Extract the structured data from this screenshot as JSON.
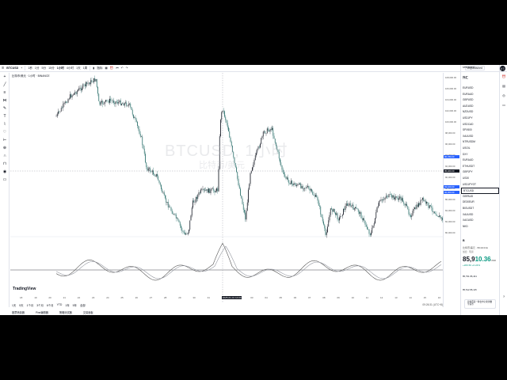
{
  "topbar": {
    "symbol": "BTCUSD",
    "intervals": [
      "1秒",
      "1分",
      "5分",
      "15分",
      "1小时",
      "4小时",
      "1天",
      "1周"
    ],
    "indicators_label": "指标",
    "publish_label": "Unpublished",
    "avatar_label": "分享"
  },
  "legend": "比特币/美元 · 1小时 · BINANCE",
  "watermark": {
    "main": "BTCUSD, 1小时",
    "sub": "比特币/美元"
  },
  "logo": "TradingView",
  "time_ticks": [
    "18",
    "19",
    "20",
    "21",
    "22",
    "23",
    "24",
    "25",
    "26",
    "27",
    "28",
    "29",
    "30",
    "31",
    "2025-01-01 14:00",
    "02",
    "03",
    "04",
    "05",
    "06",
    "07",
    "08",
    "09",
    "10",
    "11",
    "12",
    "13",
    "14",
    "15",
    "16"
  ],
  "price_labels": [
    "108,000.00",
    "106,000.00",
    "104,000.00",
    "102,000.00",
    "100,000.00",
    "98,000.00",
    "96,000.00",
    "94,000.00",
    "92,000.00",
    "90,000.00",
    "88,000.00",
    "86,000.00",
    "84,000.00",
    "82,000.00",
    "80,000.00"
  ],
  "price_badges": [
    {
      "text": "96,780.00",
      "color": "#2962ff"
    },
    {
      "text": "95,460.00",
      "color": "#131722"
    },
    {
      "text": "93,100.00",
      "color": "#2962ff"
    },
    {
      "text": "92,300.00",
      "color": "#2962ff"
    }
  ],
  "ranges": [
    "1天",
    "5天",
    "1个月",
    "3个月",
    "6个月",
    "YTD",
    "1年",
    "5年",
    "全部"
  ],
  "clock": "09:26:31 (UTC+8)",
  "footer": [
    "股票筛选器",
    "Pine编辑器",
    "策略测试器",
    "交易面板"
  ],
  "watchlist": {
    "header": "Unnamed",
    "title": "外汇",
    "items": [
      "EURUSD",
      "EURAUD",
      "GBPUSD",
      "AUDUSD",
      "NZDUSD",
      "USDJPY",
      "USDCAD",
      "SPX500",
      "XAUUSD",
      "NTRUSDM",
      "USOIL",
      "DXY",
      "EURAUD",
      "ETHUSDT",
      "GBPJPY",
      "US30",
      "USDJPYOT",
      "BTCUSD",
      "GBPAUD",
      "DE30EUR",
      "BIGUSDT",
      "XAUUSD",
      "XAGUSD",
      "NKD"
    ],
    "selected_index": 17
  },
  "detail": {
    "symbol": "B",
    "name": "比特币/美元 · BINANCE",
    "exchange": "加密 · 现货",
    "price_int": "85,9",
    "price_dec": "10.36",
    "price_unit": "USD",
    "change": "+206.50 +0.24%",
    "row1": "85,791   86,441",
    "row2": "85,512   86,115",
    "note": "比特币是一种去中心化的数字货币"
  },
  "colors": {
    "up": "#089981",
    "down": "#f23645",
    "accent": "#2962ff"
  }
}
